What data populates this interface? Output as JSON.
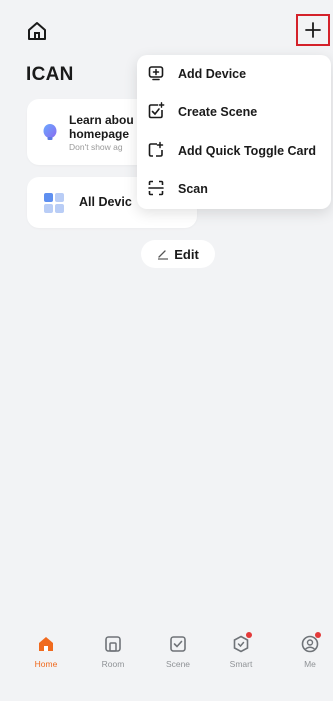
{
  "header": {
    "title": "ICAN"
  },
  "cards": {
    "learn": {
      "line1": "Learn abou",
      "line2": "homepage",
      "hint": "Don't show ag"
    },
    "devices": {
      "label": "All Devic"
    }
  },
  "edit_label": "Edit",
  "menu": {
    "items": [
      {
        "label": "Add Device",
        "icon": "add-device-icon"
      },
      {
        "label": "Create Scene",
        "icon": "create-scene-icon"
      },
      {
        "label": "Add Quick Toggle Card",
        "icon": "quick-toggle-card-icon"
      },
      {
        "label": "Scan",
        "icon": "scan-icon"
      }
    ]
  },
  "tabs": [
    {
      "label": "Home",
      "icon": "home-tab-icon",
      "active": true
    },
    {
      "label": "Room",
      "icon": "room-tab-icon",
      "active": false
    },
    {
      "label": "Scene",
      "icon": "scene-tab-icon",
      "active": false
    },
    {
      "label": "Smart",
      "icon": "smart-tab-icon",
      "active": false,
      "badge": true
    },
    {
      "label": "Me",
      "icon": "me-tab-icon",
      "active": false,
      "badge": true
    }
  ],
  "colors": {
    "background": "#f2f3f5",
    "accent": "#f06a1e",
    "highlight_border": "#d4212a",
    "badge": "#e33a3a",
    "inactive_tab": "#8f9296"
  }
}
